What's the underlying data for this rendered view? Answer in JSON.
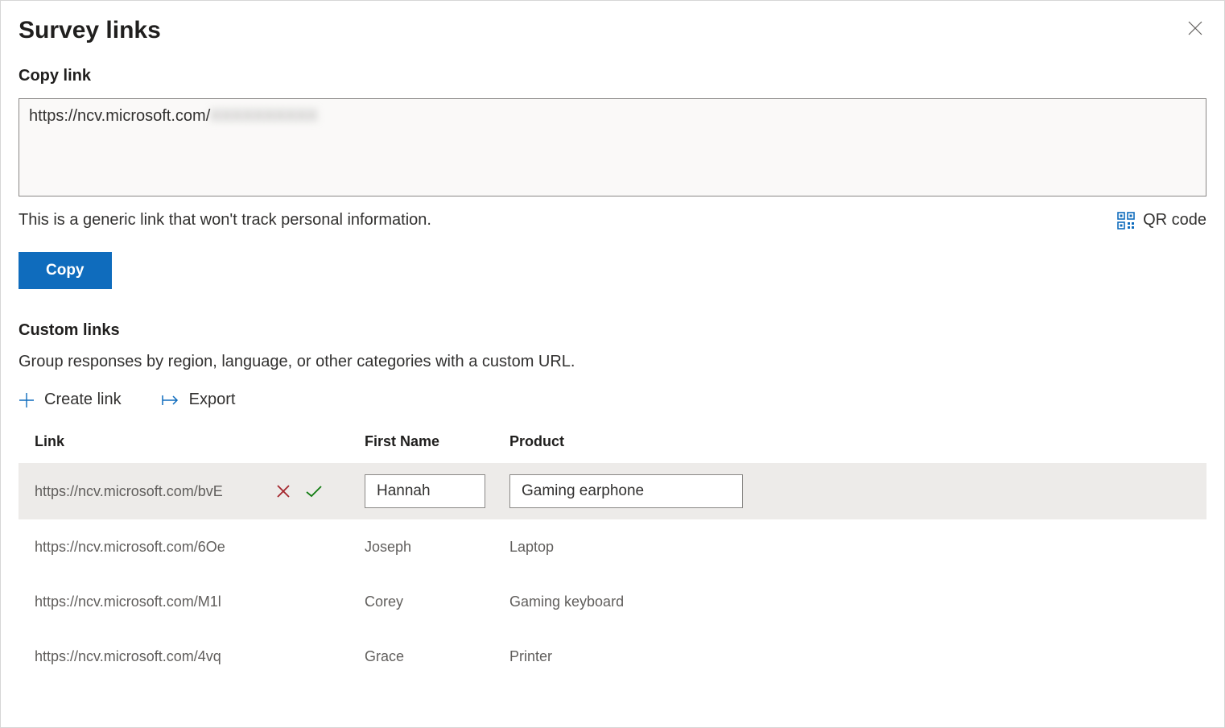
{
  "dialog": {
    "title": "Survey links"
  },
  "copy_section": {
    "heading": "Copy link",
    "url_prefix": "https://ncv.microsoft.com/",
    "url_suffix_hidden": "XXXXXXXXXX",
    "helper_text": "This is a generic link that won't track personal information.",
    "qr_label": "QR code",
    "copy_button": "Copy"
  },
  "custom_section": {
    "heading": "Custom links",
    "description": "Group responses by region, language, or other categories with a custom URL.",
    "create_link_label": "Create link",
    "export_label": "Export"
  },
  "table": {
    "columns": {
      "link": "Link",
      "first_name": "First Name",
      "product": "Product"
    },
    "rows": [
      {
        "link": "https://ncv.microsoft.com/bvE",
        "first_name": "Hannah",
        "product": "Gaming earphone",
        "editing": true
      },
      {
        "link": "https://ncv.microsoft.com/6Oe",
        "first_name": "Joseph",
        "product": "Laptop",
        "editing": false
      },
      {
        "link": "https://ncv.microsoft.com/M1l",
        "first_name": "Corey",
        "product": "Gaming keyboard",
        "editing": false
      },
      {
        "link": "https://ncv.microsoft.com/4vq",
        "first_name": "Grace",
        "product": "Printer",
        "editing": false
      }
    ]
  }
}
